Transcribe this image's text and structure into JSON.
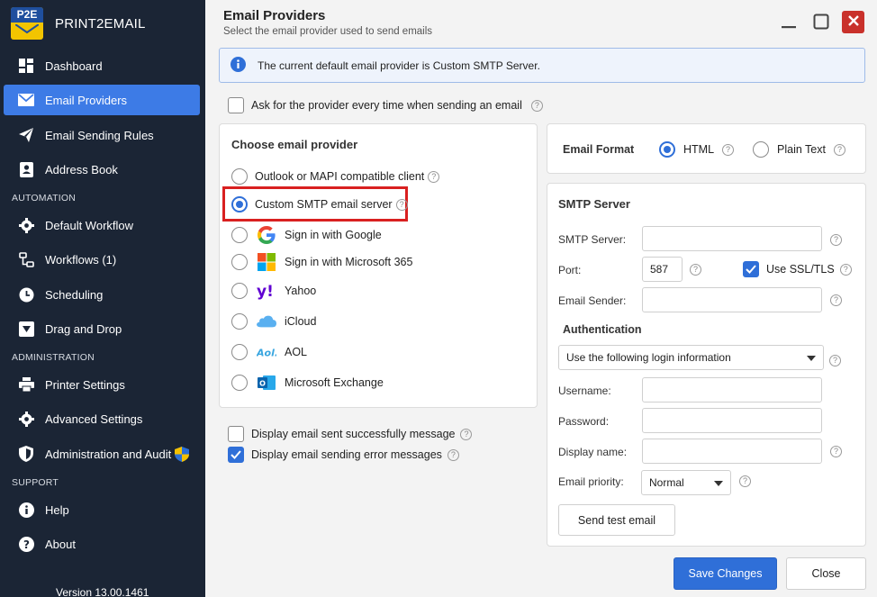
{
  "app": {
    "brand_mark": "P2E",
    "brand_name": "PRINT2EMAIL",
    "version": "Version 13.00.1461"
  },
  "sidebar": {
    "items": [
      {
        "label": "Dashboard",
        "icon": "dashboard-icon"
      },
      {
        "label": "Email Providers",
        "icon": "envelope-icon"
      },
      {
        "label": "Email Sending Rules",
        "icon": "paper-plane-icon"
      },
      {
        "label": "Address Book",
        "icon": "address-book-icon"
      },
      {
        "label": "Default Workflow",
        "icon": "gear-icon"
      },
      {
        "label": "Workflows (1)",
        "icon": "workflow-icon"
      },
      {
        "label": "Scheduling",
        "icon": "clock-icon"
      },
      {
        "label": "Drag and Drop",
        "icon": "drag-drop-icon"
      },
      {
        "label": "Printer Settings",
        "icon": "printer-icon"
      },
      {
        "label": "Advanced Settings",
        "icon": "gear-icon"
      },
      {
        "label": "Administration and Audit",
        "icon": "shield-icon"
      },
      {
        "label": "Help",
        "icon": "info-icon"
      },
      {
        "label": "About",
        "icon": "question-icon"
      }
    ],
    "sections": [
      "AUTOMATION",
      "ADMINISTRATION",
      "SUPPORT"
    ]
  },
  "header": {
    "title": "Email Providers",
    "subtitle": "Select the email provider used to send emails"
  },
  "info": {
    "text": "The current default email provider is Custom SMTP Server."
  },
  "options": {
    "ask_provider": "Ask for the provider every time when sending an email",
    "display_success": "Display email sent successfully message",
    "display_errors": "Display email sending error messages"
  },
  "providers": {
    "title": "Choose email provider",
    "items": [
      "Outlook or MAPI compatible client",
      "Custom SMTP email server",
      "Sign in with Google",
      "Sign in with Microsoft 365",
      "Yahoo",
      "iCloud",
      "AOL",
      "Microsoft Exchange"
    ],
    "selected_index": 1
  },
  "format": {
    "label": "Email Format",
    "html": "HTML",
    "plain": "Plain Text"
  },
  "smtp": {
    "title": "SMTP Server",
    "server_label": "SMTP Server:",
    "server_value": "",
    "port_label": "Port:",
    "port_value": "587",
    "ssl_label": "Use SSL/TLS",
    "sender_label": "Email Sender:",
    "sender_value": "",
    "auth_title": "Authentication",
    "auth_option": "Use the following login information",
    "username_label": "Username:",
    "password_label": "Password:",
    "display_name_label": "Display name:",
    "priority_label": "Email priority:",
    "priority_value": "Normal",
    "test_button": "Send test email"
  },
  "footer": {
    "save": "Save Changes",
    "close": "Close"
  },
  "colors": {
    "sidebar_bg": "#1b2535",
    "accent": "#3d7be6",
    "highlight": "#d92020"
  }
}
